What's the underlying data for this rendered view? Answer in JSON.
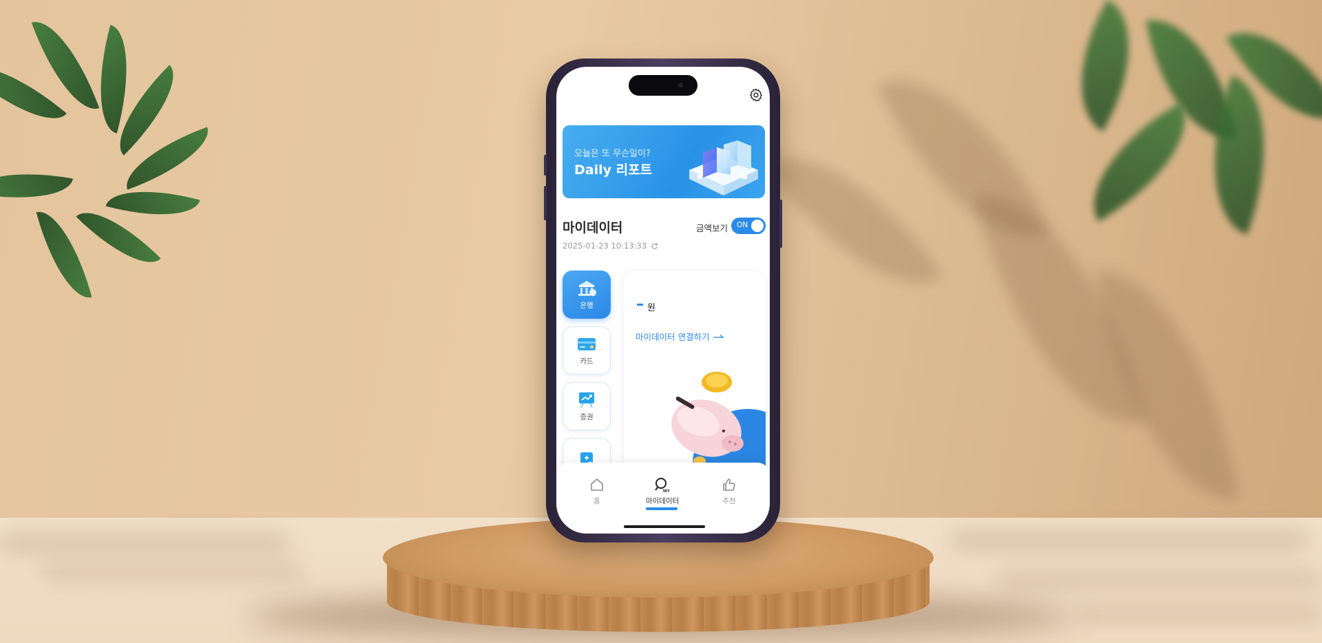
{
  "banner": {
    "subtitle": "오늘은 또 무슨일이?",
    "title": "Daily 리포트"
  },
  "mydata": {
    "title": "마이데이터",
    "timestamp": "2025-01-23 10:13:33",
    "amount_toggle_label": "금액보기",
    "toggle_state": "ON"
  },
  "categories": [
    {
      "label": "은행",
      "icon": "bank-icon",
      "active": true
    },
    {
      "label": "카드",
      "icon": "card-icon",
      "active": false
    },
    {
      "label": "증권",
      "icon": "chart-board-icon",
      "active": false
    },
    {
      "label": "",
      "icon": "insurance-document-icon",
      "active": false
    }
  ],
  "card": {
    "amount": "-",
    "currency": "원",
    "connect_link": "마이데이터 연결하기"
  },
  "tabbar": {
    "home": "홈",
    "mydata": "마이데이터",
    "recommend": "추천",
    "my_badge": "MY"
  },
  "colors": {
    "accent": "#2c8ae8",
    "banner": "#3a9ff0"
  }
}
